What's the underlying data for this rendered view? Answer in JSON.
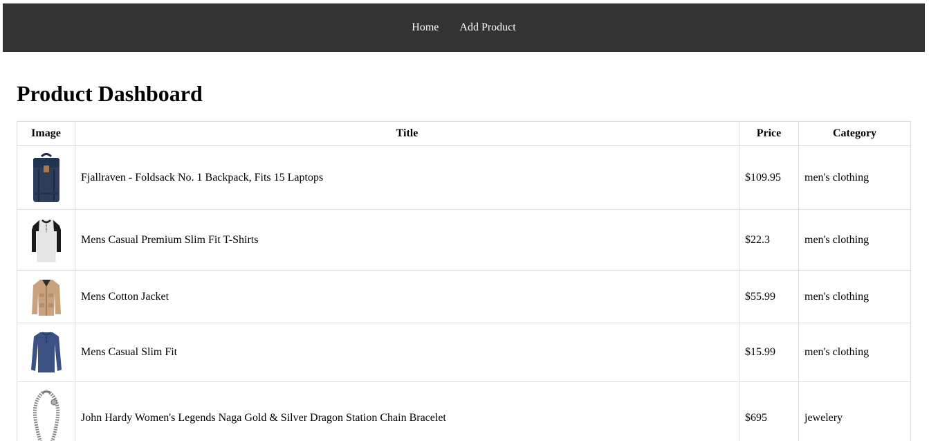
{
  "nav": {
    "home_label": "Home",
    "add_product_label": "Add Product"
  },
  "page_title": "Product Dashboard",
  "table": {
    "headers": {
      "image": "Image",
      "title": "Title",
      "price": "Price",
      "category": "Category"
    },
    "rows": [
      {
        "image_icon": "backpack-icon",
        "title": "Fjallraven - Foldsack No. 1 Backpack, Fits 15 Laptops",
        "price": "$109.95",
        "category": "men's clothing"
      },
      {
        "image_icon": "tshirt-icon",
        "title": "Mens Casual Premium Slim Fit T-Shirts",
        "price": "$22.3",
        "category": "men's clothing"
      },
      {
        "image_icon": "jacket-icon",
        "title": "Mens Cotton Jacket",
        "price": "$55.99",
        "category": "men's clothing"
      },
      {
        "image_icon": "longsleeve-shirt-icon",
        "title": "Mens Casual Slim Fit",
        "price": "$15.99",
        "category": "men's clothing"
      },
      {
        "image_icon": "bracelet-icon",
        "title": "John Hardy Women's Legends Naga Gold & Silver Dragon Station Chain Bracelet",
        "price": "$695",
        "category": "jewelery"
      }
    ]
  },
  "colors": {
    "navbar_bg": "#333333",
    "nav_text": "#ffffff",
    "border": "#dddddd"
  }
}
